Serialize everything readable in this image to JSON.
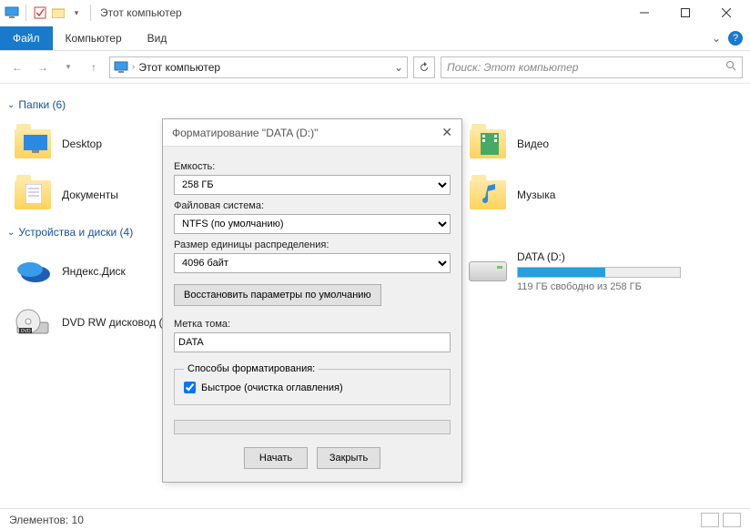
{
  "titlebar": {
    "title": "Этот компьютер"
  },
  "ribbon": {
    "file": "Файл",
    "computer": "Компьютер",
    "view": "Вид"
  },
  "navbar": {
    "crumb": "Этот компьютер",
    "search_placeholder": "Поиск: Этот компьютер"
  },
  "groups": {
    "folders": {
      "header": "Папки (6)"
    },
    "devices": {
      "header": "Устройства и диски (4)"
    }
  },
  "folders": {
    "desktop": "Desktop",
    "documents": "Документы",
    "video": "Видео",
    "music": "Музыка"
  },
  "devices": {
    "yandex": "Яндекс.Диск",
    "dvd": "DVD RW дисковод (",
    "data_name": "DATA (D:)",
    "data_sub": "119 ГБ свободно из 258 ГБ",
    "data_fill_pct": 54
  },
  "statusbar": {
    "elements": "Элементов: 10"
  },
  "dialog": {
    "title": "Форматирование \"DATA (D:)\"",
    "capacity_label": "Емкость:",
    "capacity_value": "258 ГБ",
    "fs_label": "Файловая система:",
    "fs_value": "NTFS (по умолчанию)",
    "alloc_label": "Размер единицы распределения:",
    "alloc_value": "4096 байт",
    "restore_defaults": "Восстановить параметры по умолчанию",
    "volume_label": "Метка тома:",
    "volume_value": "DATA",
    "methods_legend": "Способы форматирования:",
    "quick_format": "Быстрое (очистка оглавления)",
    "start": "Начать",
    "close": "Закрыть"
  }
}
